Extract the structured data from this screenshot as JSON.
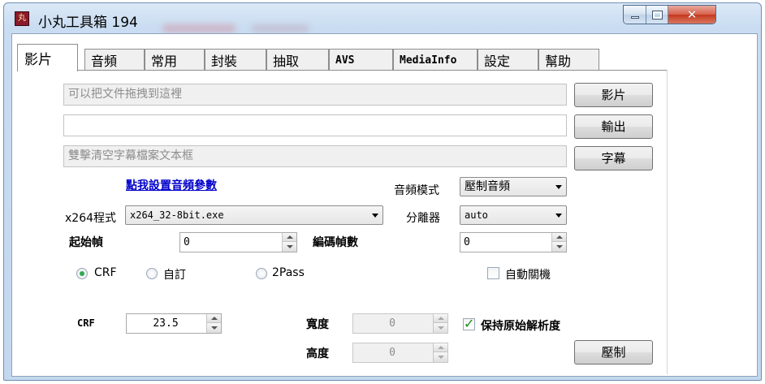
{
  "window": {
    "icon_text": "丸",
    "title": "小丸工具箱 194",
    "controls": {
      "minimize": "minimize-icon",
      "maximize": "maximize-icon",
      "close": "close-icon",
      "close_glyph": "✕"
    }
  },
  "tabs": [
    {
      "label": "影片",
      "active": true
    },
    {
      "label": "音頻"
    },
    {
      "label": "常用"
    },
    {
      "label": "封裝"
    },
    {
      "label": "抽取"
    },
    {
      "label": "AVS"
    },
    {
      "label": "MediaInfo"
    },
    {
      "label": "設定"
    },
    {
      "label": "幫助"
    }
  ],
  "video": {
    "video_file": {
      "placeholder": "可以把文件拖拽到這裡",
      "value": ""
    },
    "output_file": {
      "value": ""
    },
    "subtitle_file": {
      "placeholder": "雙擊清空字幕檔案文本框",
      "value": ""
    },
    "video_button": "影片",
    "output_button": "輸出",
    "subtitle_button": "字幕",
    "audio_settings_link": "點我設置音頻參數",
    "audio_mode_label": "音頻模式",
    "audio_mode_value": "壓制音頻",
    "x264_label": "x264程式",
    "x264_value": "x264_32-8bit.exe",
    "demuxer_label": "分離器",
    "demuxer_value": "auto",
    "start_frame_label": "起始幀",
    "start_frame_value": "0",
    "encode_frames_label": "編碼幀數",
    "encode_frames_value": "0",
    "mode_crf": "CRF",
    "mode_custom": "自訂",
    "mode_2pass": "2Pass",
    "selected_mode": "CRF",
    "auto_shutdown_label": "自動關機",
    "auto_shutdown_checked": false,
    "crf_label": "CRF",
    "crf_value": "23.5",
    "width_label": "寬度",
    "width_value": "0",
    "height_label": "高度",
    "height_value": "0",
    "keep_resolution_label": "保持原始解析度",
    "keep_resolution_checked": true,
    "encode_button": "壓制"
  }
}
